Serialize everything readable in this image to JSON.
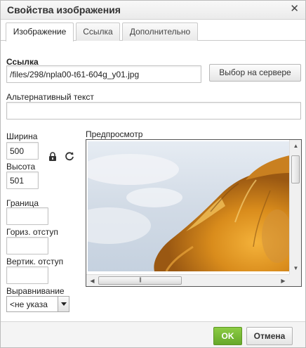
{
  "dialog": {
    "title": "Свойства изображения",
    "close_icon": "close-icon"
  },
  "tabs": [
    {
      "label": "Изображение",
      "active": true
    },
    {
      "label": "Ссылка",
      "active": false
    },
    {
      "label": "Дополнительно",
      "active": false
    }
  ],
  "url": {
    "label": "Ссылка",
    "value": "/files/298/npla00-t61-604g_y01.jpg",
    "browse_label": "Выбор на сервере"
  },
  "alt": {
    "label": "Альтернативный текст",
    "value": ""
  },
  "width": {
    "label": "Ширина",
    "value": "500"
  },
  "height": {
    "label": "Высота",
    "value": "501"
  },
  "lock_icon": "lock-icon",
  "reset_icon": "reset-size-icon",
  "border": {
    "label": "Граница",
    "value": ""
  },
  "hspace": {
    "label": "Гориз. отступ",
    "value": ""
  },
  "vspace": {
    "label": "Вертик. отступ",
    "value": ""
  },
  "align": {
    "label": "Выравнивание",
    "value": "<не указа"
  },
  "preview": {
    "label": "Предпросмотр",
    "image": "lion-mane-photo"
  },
  "footer": {
    "ok_label": "OK",
    "cancel_label": "Отмена"
  },
  "colors": {
    "ok_button": "#78b834",
    "border": "#c3c3c3"
  }
}
